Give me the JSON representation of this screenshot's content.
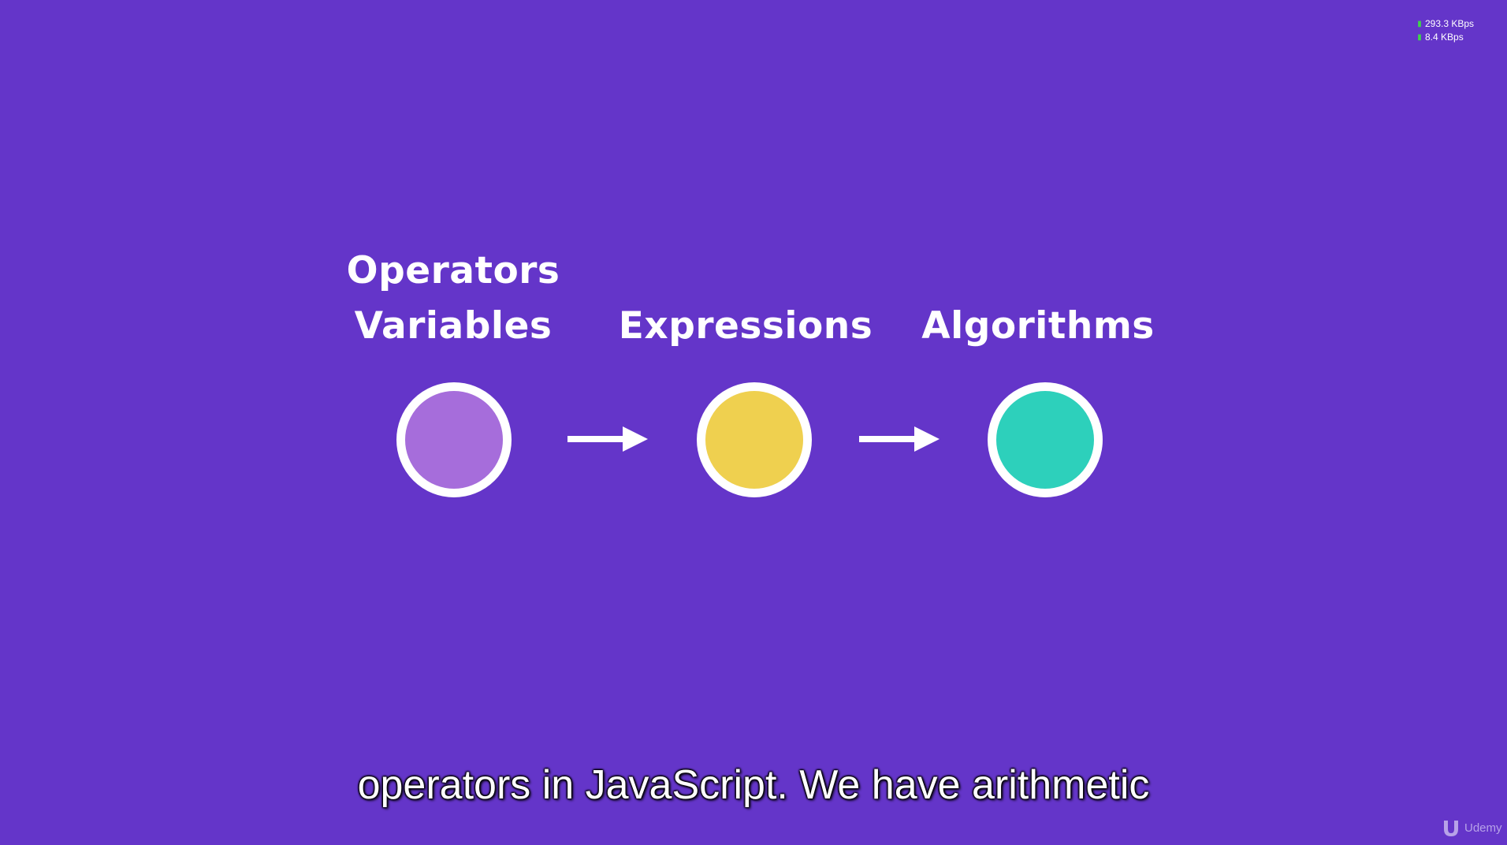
{
  "network": {
    "download": "293.3 KBps",
    "upload": "8.4 KBps"
  },
  "diagram": {
    "nodes": [
      {
        "label_top": "Operators",
        "label_bottom": "Variables",
        "color": "#a66ddb"
      },
      {
        "label": "Expressions",
        "color": "#efd04f"
      },
      {
        "label": "Algorithms",
        "color": "#2dd0bb"
      }
    ]
  },
  "subtitle": "operators in JavaScript. We have arithmetic",
  "brand": {
    "name": "Udemy"
  },
  "colors": {
    "background": "#6435c9",
    "ring": "#ffffff"
  }
}
